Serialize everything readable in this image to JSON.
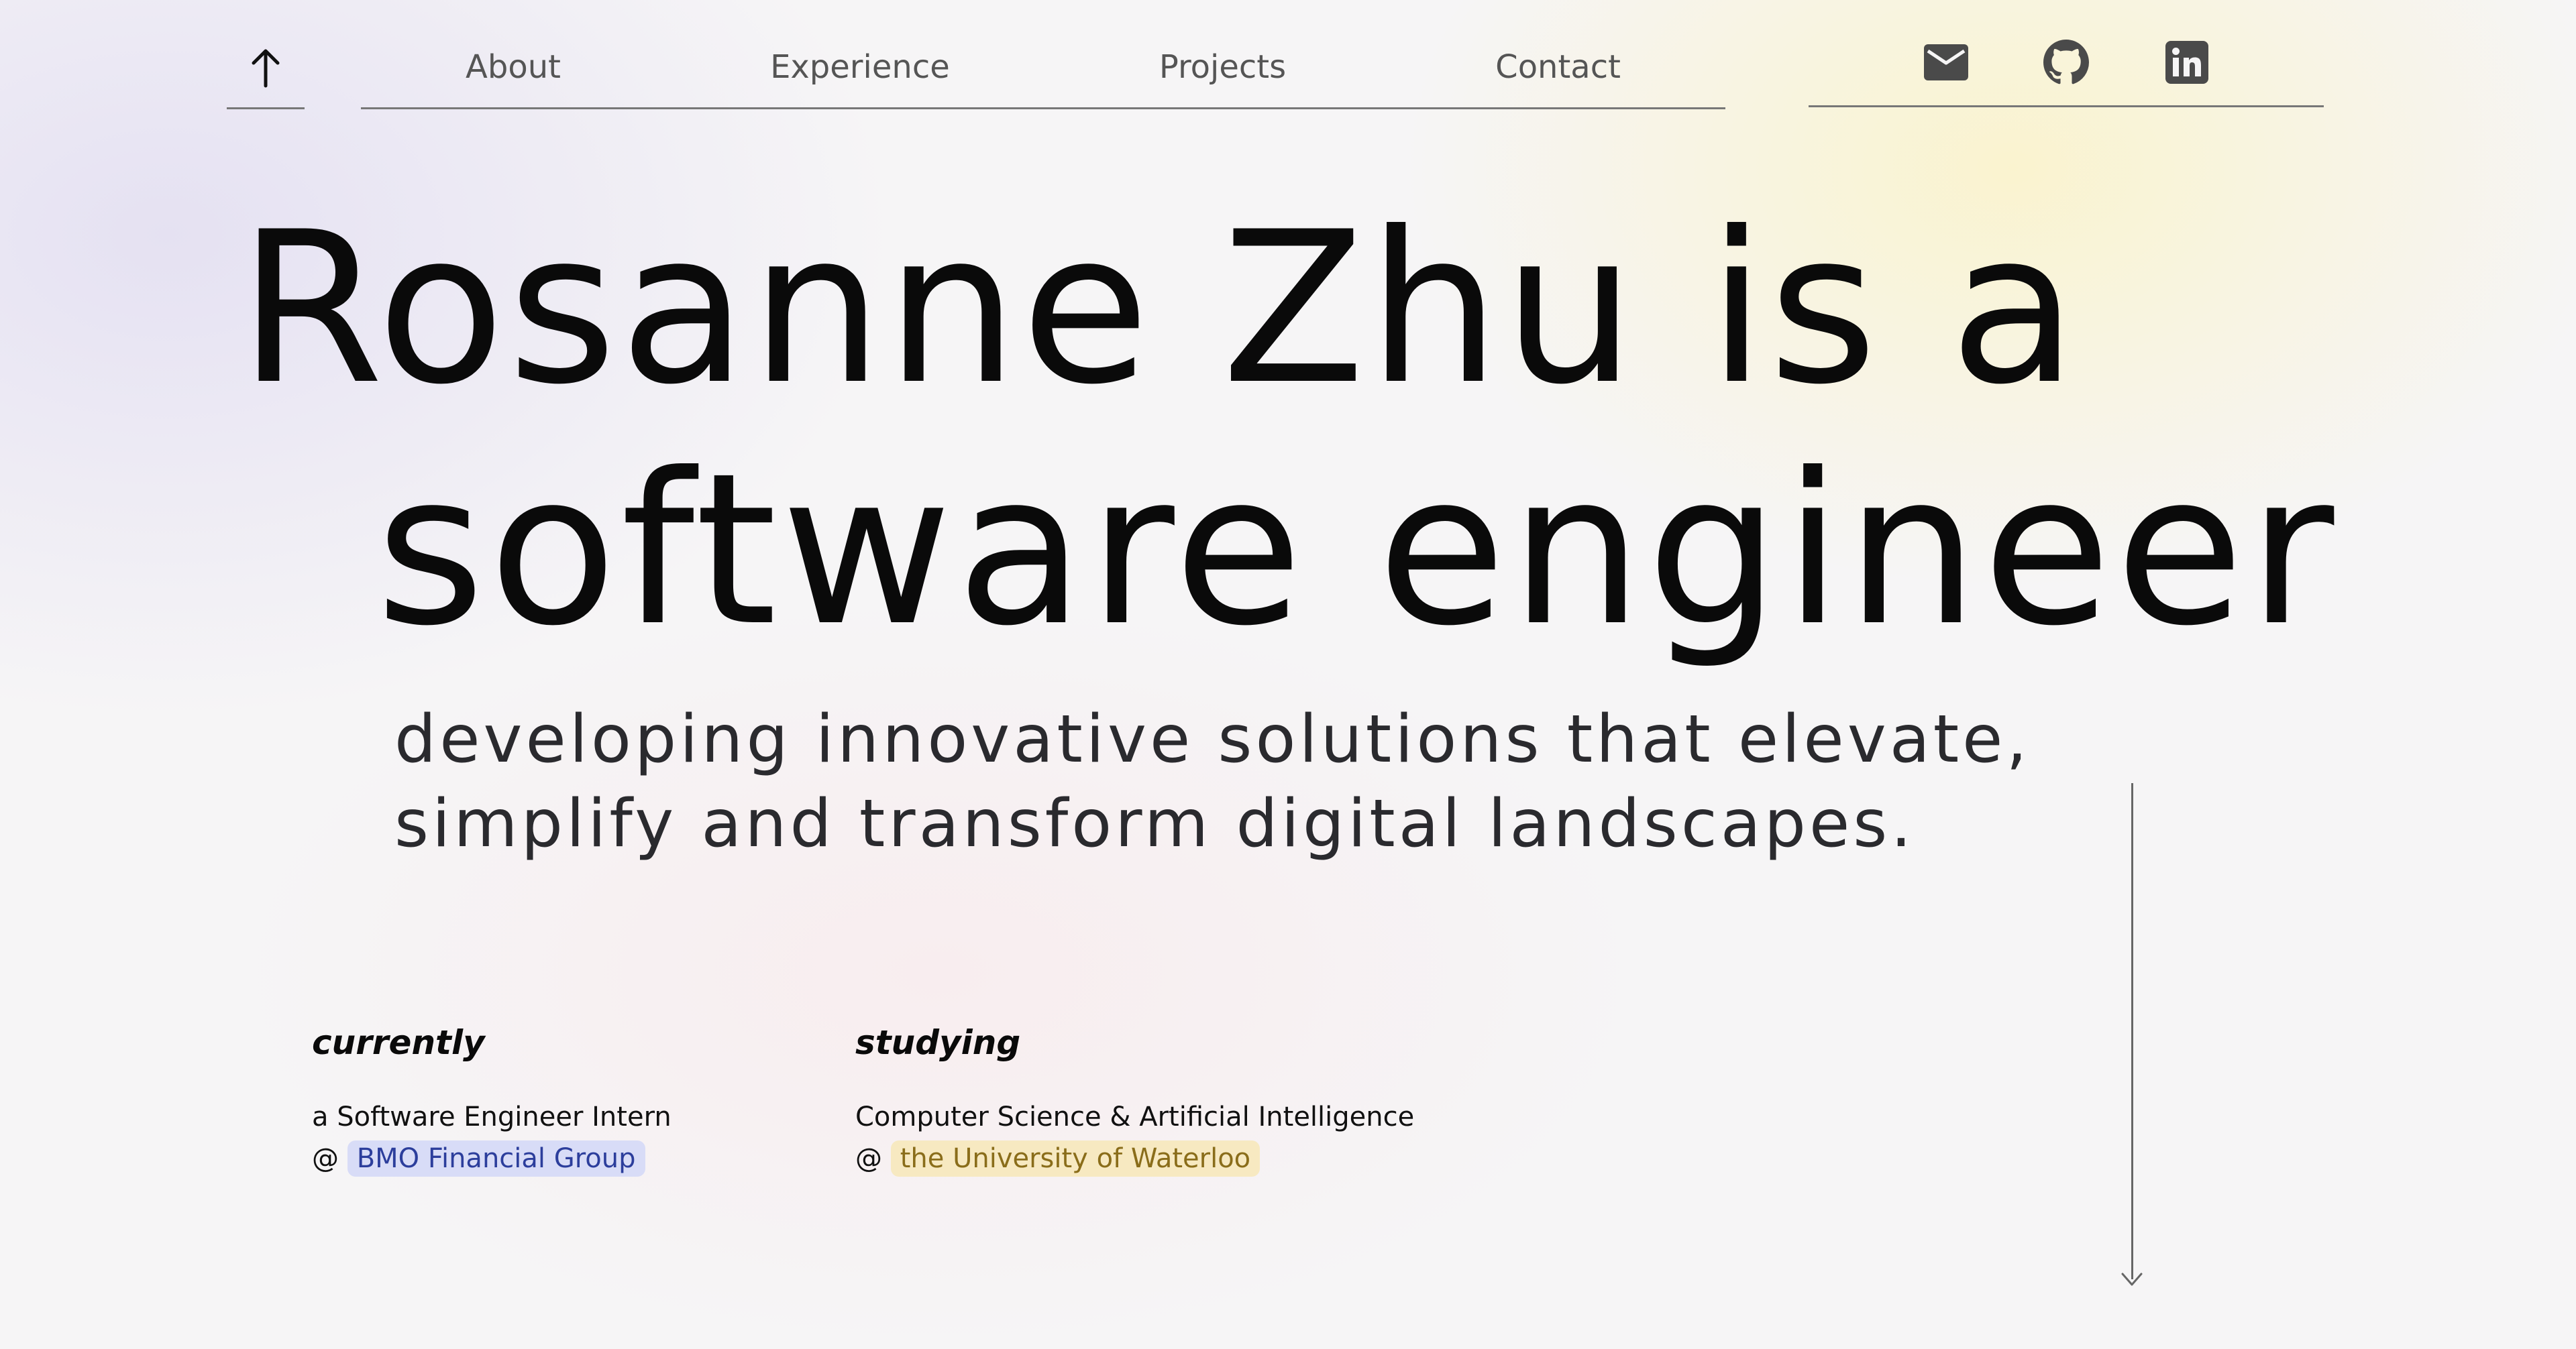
{
  "nav": {
    "top_button_icon": "arrow-up-icon",
    "links": [
      {
        "label": "About"
      },
      {
        "label": "Experience"
      },
      {
        "label": "Projects"
      },
      {
        "label": "Contact"
      }
    ],
    "socials": [
      {
        "icon": "mail-icon"
      },
      {
        "icon": "github-icon"
      },
      {
        "icon": "linkedin-icon"
      }
    ]
  },
  "hero": {
    "line1": "Rosanne Zhu is a",
    "line2": "software engineer",
    "tagline_line1": "developing innovative solutions that elevate,",
    "tagline_line2": "simplify and transform digital landscapes."
  },
  "currently": {
    "heading": "currently",
    "role": "a Software Engineer Intern",
    "at_symbol": "@",
    "organization": "BMO Financial Group"
  },
  "studying": {
    "heading": "studying",
    "program": "Computer Science & Artificial Intelligence",
    "at_symbol": "@",
    "institution": "the University of Waterloo"
  },
  "scroll_indicator_icon": "arrow-down-icon",
  "colors": {
    "text": "#0a0a0a",
    "nav_text": "#555555",
    "icon": "#4a4a4a",
    "highlight_blue_bg": "#d8dcf7",
    "highlight_blue_text": "#2c3e9c",
    "highlight_yellow_bg": "#f7e9c1",
    "highlight_yellow_text": "#8a6d1a",
    "rule": "#777777"
  }
}
